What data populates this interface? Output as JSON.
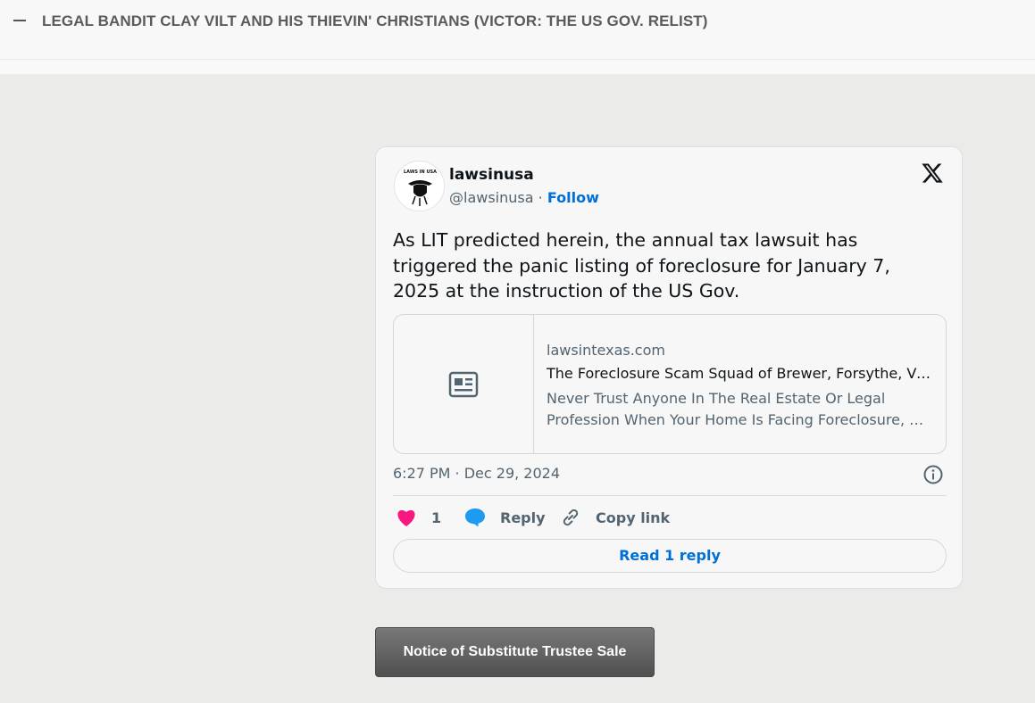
{
  "section": {
    "title": "LEGAL BANDIT CLAY VILT AND HIS THIEVIN' CHRISTIANS (VICTOR: THE US GOV. RELIST)"
  },
  "tweet": {
    "user_name": "lawsinusa",
    "handle": "@lawsinusa",
    "separator": "·",
    "follow_label": "Follow",
    "avatar_icon": "laws-in-usa-logo",
    "avatar_text": "LAWS IN USA",
    "text": "As LIT predicted herein, the annual tax lawsuit has triggered the panic listing of foreclosure for January 7, 2025 at the instruction of the US Gov.",
    "link_card": {
      "domain": "lawsintexas.com",
      "title": "The Foreclosure Scam Squad of Brewer, Forsythe, Vilt & Vilt",
      "description_line1": "Never Trust Anyone In The Real Estate Or Legal",
      "description_line2": "Profession When Your Home Is Facing Foreclosure, Unless"
    },
    "timestamp": "6:27 PM · Dec 29, 2024",
    "actions": {
      "like_count": "1",
      "reply_label": "Reply",
      "copy_label": "Copy link"
    },
    "read_reply_label": "Read 1 reply"
  },
  "cta_button": {
    "label": "Notice of Substitute Trustee Sale"
  },
  "colors": {
    "accent": "#006fd6",
    "like": "#f91880",
    "reply": "#1d9bf0",
    "page_bg": "#ebebea"
  }
}
